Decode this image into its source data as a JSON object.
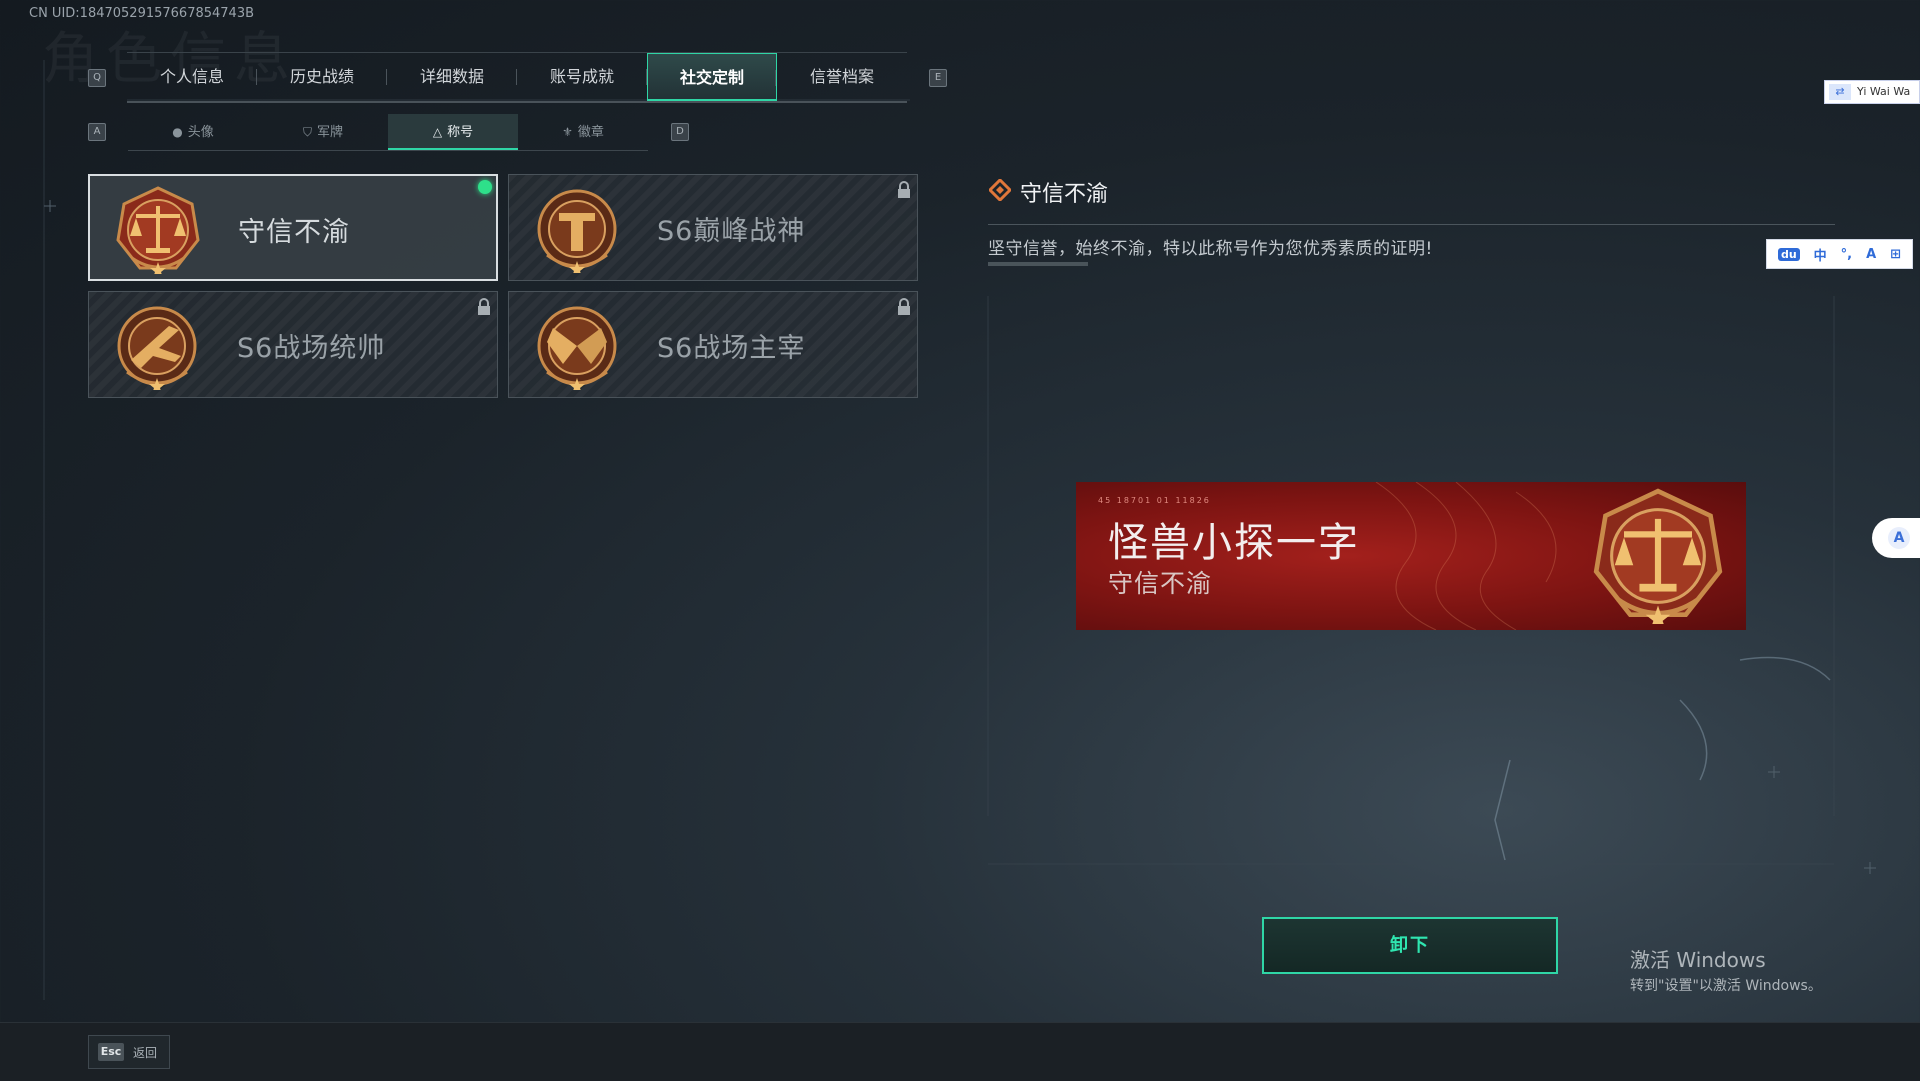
{
  "uid": "CN UID:18470529157667854743B",
  "watermark_title": "角色信息",
  "main_tabs": {
    "left_key": "Q",
    "right_key": "E",
    "items": [
      {
        "label": "个人信息"
      },
      {
        "label": "历史战绩"
      },
      {
        "label": "详细数据"
      },
      {
        "label": "账号成就"
      },
      {
        "label": "社交定制"
      },
      {
        "label": "信誉档案"
      }
    ],
    "active_index": 4
  },
  "sub_tabs": {
    "left_key": "A",
    "right_key": "D",
    "items": [
      {
        "label": "头像",
        "icon": "person-icon"
      },
      {
        "label": "军牌",
        "icon": "dogtag-icon"
      },
      {
        "label": "称号",
        "icon": "triangle-badge-icon"
      },
      {
        "label": "徽章",
        "icon": "wings-badge-icon"
      }
    ],
    "active_index": 2
  },
  "titles": [
    {
      "name": "守信不渝",
      "medal": "scales-medal",
      "selected": true,
      "locked": false
    },
    {
      "name": "S6巅峰战神",
      "medal": "t-shield-medal",
      "selected": false,
      "locked": true
    },
    {
      "name": "S6战场统帅",
      "medal": "jet-medal",
      "selected": false,
      "locked": true
    },
    {
      "name": "S6战场主宰",
      "medal": "crossed-flags-medal",
      "selected": false,
      "locked": true
    }
  ],
  "detail": {
    "title": "守信不渝",
    "description": "坚守信誉，始终不渝，特以此称号作为您优秀素质的证明!"
  },
  "banner": {
    "player_name": "怪兽小探一字",
    "title": "守信不渝",
    "code": "45 18701   01 11826"
  },
  "unequip_button": "卸下",
  "activate_windows": {
    "line1": "激活 Windows",
    "line2": "转到\"设置\"以激活 Windows。"
  },
  "esc": {
    "key": "Esc",
    "label": "返回"
  },
  "ime": {
    "top_label": "Yi Wai Wa",
    "toolbar": [
      "du",
      "中",
      "°,",
      "A",
      "⊞"
    ]
  },
  "colors": {
    "accent": "#2fd6a6",
    "selected_dot": "#2ee08a",
    "banner_red": "#8a1714",
    "medal_bronze": "#c88a4a"
  }
}
